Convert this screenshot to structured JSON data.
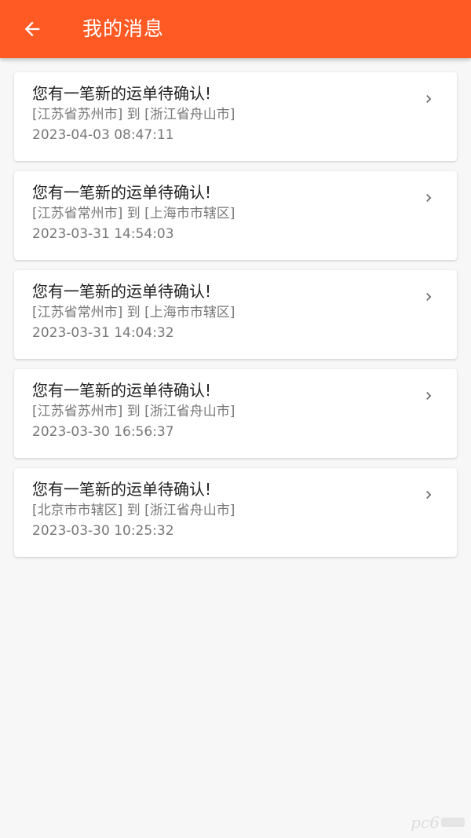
{
  "header": {
    "title": "我的消息",
    "back_icon": "arrow-left-icon",
    "background_color": "#ff5a24"
  },
  "messages": [
    {
      "title": "您有一笔新的运单待确认!",
      "route": "[江苏省苏州市] 到 [浙江省舟山市]",
      "time": "2023-04-03 08:47:11"
    },
    {
      "title": "您有一笔新的运单待确认!",
      "route": "[江苏省常州市] 到 [上海市市辖区]",
      "time": "2023-03-31 14:54:03"
    },
    {
      "title": "您有一笔新的运单待确认!",
      "route": "[江苏省常州市] 到 [上海市市辖区]",
      "time": "2023-03-31 14:04:32"
    },
    {
      "title": "您有一笔新的运单待确认!",
      "route": "[江苏省苏州市] 到 [浙江省舟山市]",
      "time": "2023-03-30 16:56:37"
    },
    {
      "title": "您有一笔新的运单待确认!",
      "route": "[北京市市辖区] 到 [浙江省舟山市]",
      "time": "2023-03-30 10:25:32"
    }
  ],
  "chevron_icon": "chevron-right-icon",
  "watermark": {
    "text": "pc6"
  }
}
